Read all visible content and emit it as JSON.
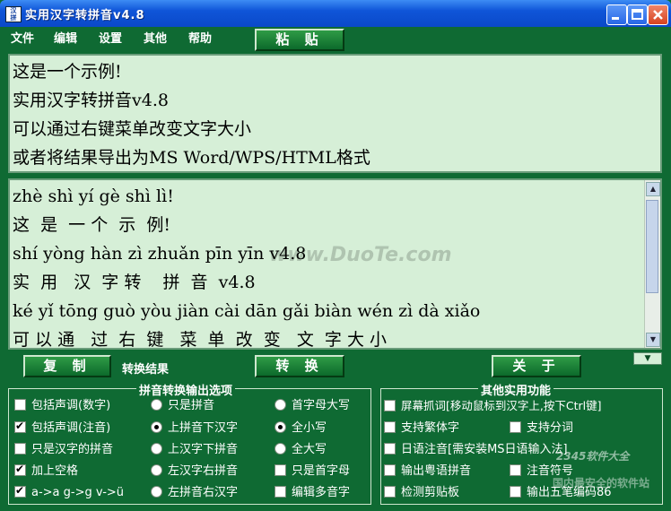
{
  "window": {
    "title": "实用汉字转拼音v4.8",
    "icon": "app-icon"
  },
  "menu": [
    "文件",
    "编辑",
    "设置",
    "其他",
    "帮助"
  ],
  "paste_button": "粘 贴",
  "source_lines": [
    "这是一个示例!",
    "实用汉字转拼音v4.8",
    "可以通过右键菜单改变文字大小",
    "或者将结果导出为MS Word/WPS/HTML格式"
  ],
  "result_lines": [
    "zhè shì yí gè shì lì!",
    "这  是  一 个  示  例!",
    "shí yòng hàn zì zhuǎn pīn yīn v4.8",
    "实  用   汉  字 转    拼  音  v4.8",
    "ké yǐ tōng guò yòu jiàn cài dān gǎi biàn wén zì dà xiǎo",
    "可 以 通   过  右  键   菜  单  改  变   文  字 大 小"
  ],
  "buttons": {
    "copy": "复 制",
    "convert_result": "转换结果",
    "convert": "转 换",
    "about": "关 于"
  },
  "pinyin_options": {
    "legend": "拼音转换输出选项",
    "col1": [
      {
        "label": "包括声调(数字)",
        "checked": false
      },
      {
        "label": "包括声调(注音)",
        "checked": true
      },
      {
        "label": "只是汉字的拼音",
        "checked": false
      },
      {
        "label": "加上空格",
        "checked": true
      },
      {
        "label": "a->a g->g v->ü",
        "checked": true
      }
    ],
    "col2": [
      {
        "label": "只是拼音",
        "checked": false
      },
      {
        "label": "上拼音下汉字",
        "checked": true
      },
      {
        "label": "上汉字下拼音",
        "checked": false
      },
      {
        "label": "左汉字右拼音",
        "checked": false
      },
      {
        "label": "左拼音右汉字",
        "checked": false
      }
    ],
    "col3": [
      {
        "label": "首字母大写",
        "checked": false,
        "type": "radio"
      },
      {
        "label": "全小写",
        "checked": true,
        "type": "radio"
      },
      {
        "label": "全大写",
        "checked": false,
        "type": "radio"
      },
      {
        "label": "只是首字母",
        "checked": false,
        "type": "check"
      },
      {
        "label": "编辑多音字",
        "checked": false,
        "type": "check"
      }
    ]
  },
  "other_functions": {
    "legend": "其他实用功能",
    "items": [
      {
        "label": "屏幕抓词[移动鼠标到汉字上,按下Ctrl键]",
        "checked": false
      },
      {
        "label": "支持繁体字",
        "checked": false
      },
      {
        "label": "支持分词",
        "checked": false
      },
      {
        "label": "日语注音[需安装MS日语输入法]",
        "checked": false
      },
      {
        "label": "输出粤语拼音",
        "checked": false
      },
      {
        "label": "注音符号",
        "checked": false
      },
      {
        "label": "检测剪贴板",
        "checked": false
      },
      {
        "label": "输出五笔编码86",
        "checked": false
      }
    ]
  },
  "watermarks": [
    "www.DuoTe.com",
    "2345软件大全",
    "国内最安全的软件站"
  ]
}
